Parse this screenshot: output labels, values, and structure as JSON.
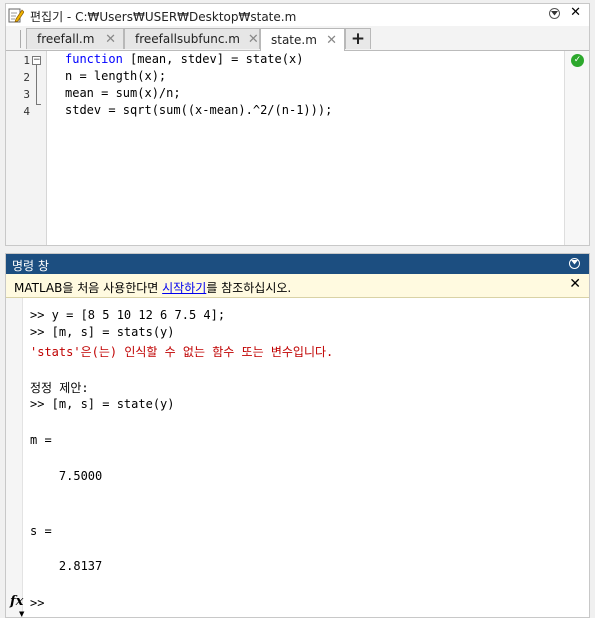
{
  "editor": {
    "title": "편집기 - C:₩Users₩USER₩Desktop₩state.m",
    "tabs": [
      {
        "label": "freefall.m",
        "active": false
      },
      {
        "label": "freefallsubfunc.m",
        "active": false
      },
      {
        "label": "state.m",
        "active": true
      }
    ],
    "add_tab_label": "+",
    "line_numbers": [
      "1",
      "2",
      "3",
      "4"
    ],
    "code": {
      "l1_keyword": "function",
      "l1_rest": " [mean, stdev] = state(x)",
      "l2": "n = length(x);",
      "l3": "mean = sum(x)/n;",
      "l4": "stdev = sqrt(sum((x-mean).^2/(n-1)));"
    },
    "status_icon": "check-circle-icon"
  },
  "command_window": {
    "title": "명령 창",
    "notice": {
      "before": "MATLAB을 처음 사용한다면 ",
      "link": "시작하기",
      "after": "를 참조하십시오."
    },
    "lines": {
      "l1": ">> y = [8 5 10 12 6 7.5 4];",
      "l2": ">> [m, s] = stats(y)",
      "l3": "'stats'은(는) 인식할 수 없는 함수 또는 변수입니다.",
      "l4": "정정 제안:",
      "l5": ">> [m, s] = state(y)",
      "l6": "m =",
      "l7": "    7.5000",
      "l8": "s =",
      "l9": "    2.8137",
      "prompt": ">>"
    },
    "fx_label": "fx"
  },
  "colors": {
    "keyword": "#0000ff",
    "error": "#c00000",
    "header_bg": "#1c4e80",
    "notice_bg": "#fffae0"
  }
}
